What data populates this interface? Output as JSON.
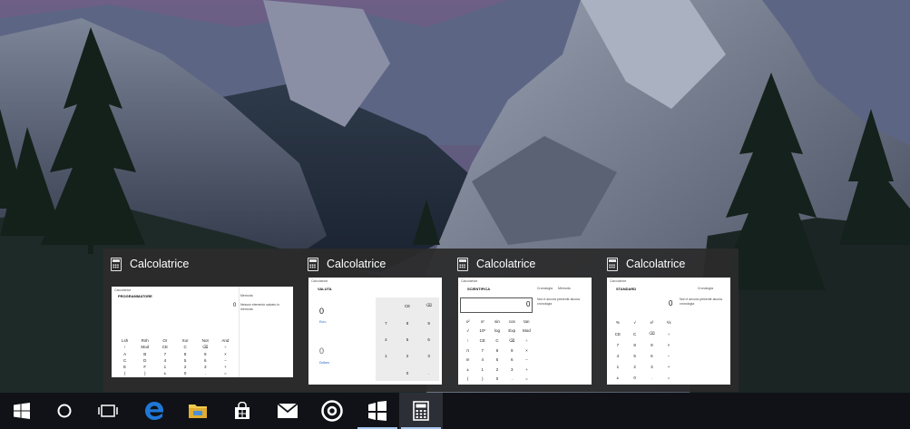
{
  "colors": {
    "flyout_bg": "#2b2b2b",
    "taskbar_bg": "#101217",
    "accent_underline": "#a8c8f0",
    "edge_blue": "#1f77d6",
    "explorer_yellow": "#f2c94c"
  },
  "flyout": {
    "thumbnails": [
      {
        "title": "Calcolatrice",
        "icon": "calculator-icon",
        "window": {
          "app": "Calcolatrice",
          "mode": "PROGRAMMATORE",
          "display": "0",
          "side_header": "Memoria",
          "side_text": "Nessun elemento salvato in memoria",
          "keys": [
            "Lsh",
            "Rsh",
            "Or",
            "Xor",
            "Not",
            "And",
            "↑",
            "Mod",
            "CE",
            "C",
            "⌫",
            "÷",
            "A",
            "B",
            "7",
            "8",
            "9",
            "×",
            "C",
            "D",
            "4",
            "5",
            "6",
            "−",
            "E",
            "F",
            "1",
            "2",
            "3",
            "+",
            "(",
            ")",
            "±",
            "0",
            ".",
            "="
          ]
        }
      },
      {
        "title": "Calcolatrice",
        "icon": "calculator-icon",
        "window": {
          "app": "Calcolatrice",
          "mode": "VALUTA",
          "display_top": "0",
          "unit_top": "Euro",
          "display_bottom": "0",
          "unit_bottom": "Dollaro",
          "link": "Aggiornato il 08/06/2016",
          "keys": [
            "",
            "CE",
            "⌫",
            "7",
            "8",
            "9",
            "4",
            "5",
            "6",
            "1",
            "2",
            "3",
            "",
            "0",
            "."
          ]
        }
      },
      {
        "title": "Calcolatrice",
        "icon": "calculator-icon",
        "window": {
          "app": "Calcolatrice",
          "mode": "SCIENTIFICA",
          "tab_history": "Cronologia",
          "tab_memory": "Memoria",
          "display": "0",
          "side_text": "Non è ancora presente alcuna cronologia",
          "keys": [
            "x²",
            "xʸ",
            "sin",
            "cos",
            "tan",
            "√",
            "10ˣ",
            "log",
            "Exp",
            "Mod",
            "↑",
            "CE",
            "C",
            "⌫",
            "÷",
            "π",
            "7",
            "8",
            "9",
            "×",
            "n!",
            "4",
            "5",
            "6",
            "−",
            "±",
            "1",
            "2",
            "3",
            "+",
            "(",
            ")",
            "0",
            ".",
            "="
          ]
        }
      },
      {
        "title": "Calcolatrice",
        "icon": "calculator-icon",
        "window": {
          "app": "Calcolatrice",
          "mode": "STANDARD",
          "tab_history": "Cronologia",
          "display": "0",
          "side_text": "Non è ancora presente alcuna cronologia",
          "keys": [
            "%",
            "√",
            "x²",
            "¹/x",
            "CE",
            "C",
            "⌫",
            "÷",
            "7",
            "8",
            "9",
            "×",
            "4",
            "5",
            "6",
            "−",
            "1",
            "2",
            "3",
            "+",
            "±",
            "0",
            ".",
            "="
          ]
        }
      }
    ]
  },
  "taskbar": {
    "items": [
      {
        "name": "start-button",
        "icon": "windows-logo-icon"
      },
      {
        "name": "cortana-button",
        "icon": "cortana-circle-icon"
      },
      {
        "name": "task-view-button",
        "icon": "task-view-icon"
      },
      {
        "name": "taskbar-edge",
        "icon": "edge-icon"
      },
      {
        "name": "taskbar-file-explorer",
        "icon": "folder-icon"
      },
      {
        "name": "taskbar-store",
        "icon": "store-bag-icon"
      },
      {
        "name": "taskbar-mail",
        "icon": "mail-icon"
      },
      {
        "name": "taskbar-groove",
        "icon": "groove-music-icon"
      },
      {
        "name": "taskbar-app",
        "icon": "tiles-app-icon"
      },
      {
        "name": "taskbar-calculator",
        "icon": "calculator-icon"
      }
    ]
  }
}
